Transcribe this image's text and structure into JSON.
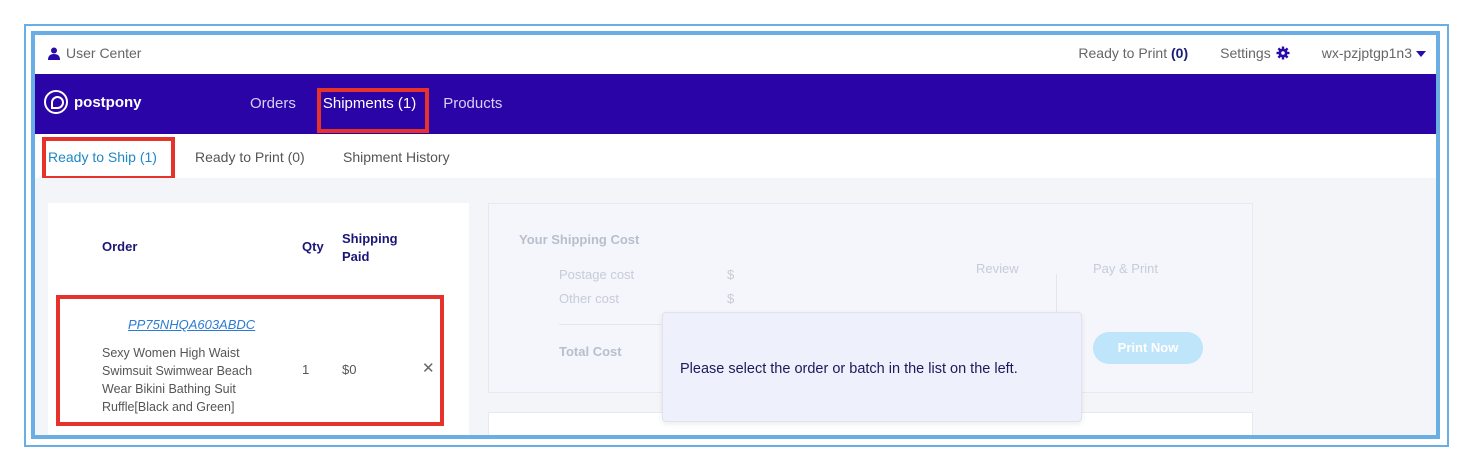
{
  "topbar": {
    "user_center": "User Center",
    "ready_to_print_label": "Ready to Print",
    "ready_to_print_count": "(0)",
    "settings": "Settings",
    "account": "wx-pzjptgp1n3"
  },
  "navbar": {
    "brand": "postpony",
    "items": [
      "Orders",
      "Shipments (1)",
      "Products"
    ]
  },
  "subtabs": [
    "Ready to Ship (1)",
    "Ready to Print (0)",
    "Shipment History"
  ],
  "orders_table": {
    "headers": {
      "order": "Order",
      "qty": "Qty",
      "shipping_paid": "Shipping Paid"
    },
    "rows": [
      {
        "order_id": "PP75NHQA603ABDC",
        "description": "Sexy Women High Waist Swimsuit Swimwear Beach Wear Bikini Bathing Suit Ruffle[Black and Green]",
        "qty": "1",
        "shipping_paid": "$0"
      }
    ]
  },
  "shipping_cost": {
    "title": "Your Shipping Cost",
    "postage_label": "Postage cost",
    "postage_value": "$",
    "other_label": "Other cost",
    "other_value": "$",
    "total_label": "Total Cost",
    "review": "Review",
    "pay_print": "Pay & Print",
    "print_now": "Print Now"
  },
  "tooltip": "Please select the order or batch in the list on the left.",
  "colors": {
    "nav_bg": "#2a04a6",
    "highlight": "#e5322b",
    "frame": "#6aaee4",
    "link": "#2b7bd1"
  }
}
